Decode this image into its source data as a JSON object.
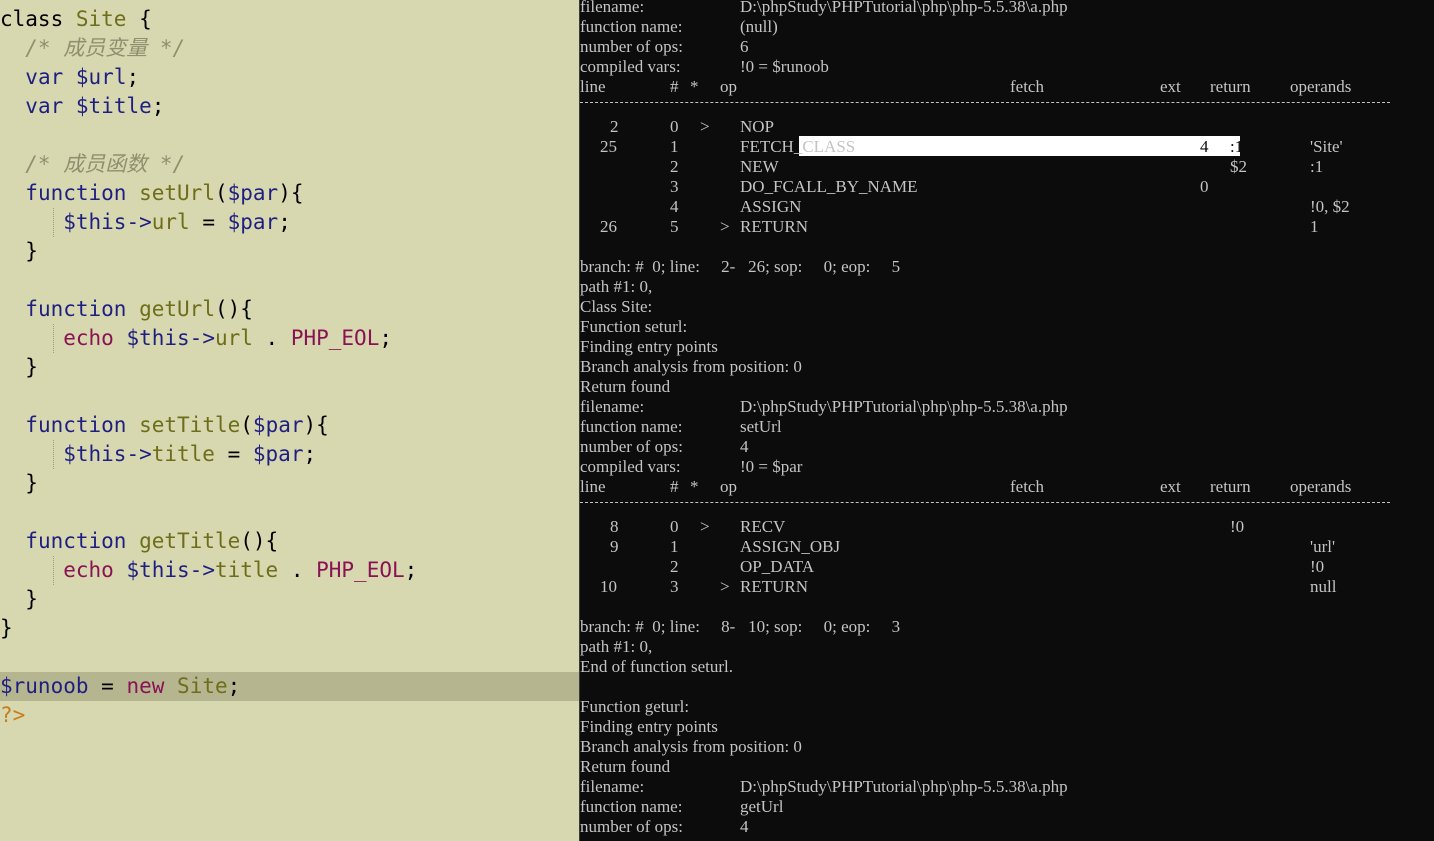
{
  "editor": {
    "lines": [
      [
        {
          "t": "class",
          "c": "plain"
        },
        {
          "t": " ",
          "c": "plain"
        },
        {
          "t": "Site",
          "c": "cls"
        },
        {
          "t": " {",
          "c": "plain"
        }
      ],
      [
        {
          "t": "  /* 成员变量 */",
          "c": "cmt"
        }
      ],
      [
        {
          "t": "  ",
          "c": "plain"
        },
        {
          "t": "var",
          "c": "kw"
        },
        {
          "t": " ",
          "c": "plain"
        },
        {
          "t": "$url",
          "c": "var"
        },
        {
          "t": ";",
          "c": "plain"
        }
      ],
      [
        {
          "t": "  ",
          "c": "plain"
        },
        {
          "t": "var",
          "c": "kw"
        },
        {
          "t": " ",
          "c": "plain"
        },
        {
          "t": "$title",
          "c": "var"
        },
        {
          "t": ";",
          "c": "plain"
        }
      ],
      [],
      [
        {
          "t": "  /* 成员函数 */",
          "c": "cmt"
        }
      ],
      [
        {
          "t": "  ",
          "c": "plain"
        },
        {
          "t": "function",
          "c": "kw"
        },
        {
          "t": " ",
          "c": "plain"
        },
        {
          "t": "setUrl",
          "c": "fn"
        },
        {
          "t": "(",
          "c": "plain"
        },
        {
          "t": "$par",
          "c": "var"
        },
        {
          "t": "){",
          "c": "plain"
        }
      ],
      [
        {
          "t": "     ",
          "c": "plain"
        },
        {
          "t": "$this",
          "c": "var"
        },
        {
          "t": "->",
          "c": "var"
        },
        {
          "t": "url",
          "c": "prop"
        },
        {
          "t": " = ",
          "c": "plain"
        },
        {
          "t": "$par",
          "c": "var"
        },
        {
          "t": ";",
          "c": "plain"
        }
      ],
      [
        {
          "t": "  }",
          "c": "plain"
        }
      ],
      [],
      [
        {
          "t": "  ",
          "c": "plain"
        },
        {
          "t": "function",
          "c": "kw"
        },
        {
          "t": " ",
          "c": "plain"
        },
        {
          "t": "getUrl",
          "c": "fn"
        },
        {
          "t": "(){",
          "c": "plain"
        }
      ],
      [
        {
          "t": "     ",
          "c": "plain"
        },
        {
          "t": "echo",
          "c": "const"
        },
        {
          "t": " ",
          "c": "plain"
        },
        {
          "t": "$this",
          "c": "var"
        },
        {
          "t": "->",
          "c": "var"
        },
        {
          "t": "url",
          "c": "prop"
        },
        {
          "t": " . ",
          "c": "plain"
        },
        {
          "t": "PHP_EOL",
          "c": "const"
        },
        {
          "t": ";",
          "c": "plain"
        }
      ],
      [
        {
          "t": "  }",
          "c": "plain"
        }
      ],
      [],
      [
        {
          "t": "  ",
          "c": "plain"
        },
        {
          "t": "function",
          "c": "kw"
        },
        {
          "t": " ",
          "c": "plain"
        },
        {
          "t": "setTitle",
          "c": "fn"
        },
        {
          "t": "(",
          "c": "plain"
        },
        {
          "t": "$par",
          "c": "var"
        },
        {
          "t": "){",
          "c": "plain"
        }
      ],
      [
        {
          "t": "     ",
          "c": "plain"
        },
        {
          "t": "$this",
          "c": "var"
        },
        {
          "t": "->",
          "c": "var"
        },
        {
          "t": "title",
          "c": "prop"
        },
        {
          "t": " = ",
          "c": "plain"
        },
        {
          "t": "$par",
          "c": "var"
        },
        {
          "t": ";",
          "c": "plain"
        }
      ],
      [
        {
          "t": "  }",
          "c": "plain"
        }
      ],
      [],
      [
        {
          "t": "  ",
          "c": "plain"
        },
        {
          "t": "function",
          "c": "kw"
        },
        {
          "t": " ",
          "c": "plain"
        },
        {
          "t": "getTitle",
          "c": "fn"
        },
        {
          "t": "(){",
          "c": "plain"
        }
      ],
      [
        {
          "t": "     ",
          "c": "plain"
        },
        {
          "t": "echo",
          "c": "const"
        },
        {
          "t": " ",
          "c": "plain"
        },
        {
          "t": "$this",
          "c": "var"
        },
        {
          "t": "->",
          "c": "var"
        },
        {
          "t": "title",
          "c": "prop"
        },
        {
          "t": " . ",
          "c": "plain"
        },
        {
          "t": "PHP_EOL",
          "c": "const"
        },
        {
          "t": ";",
          "c": "plain"
        }
      ],
      [
        {
          "t": "  }",
          "c": "plain"
        }
      ],
      [
        {
          "t": "}",
          "c": "plain"
        }
      ],
      [],
      [
        {
          "t": "$runoob",
          "c": "var"
        },
        {
          "t": " = ",
          "c": "plain"
        },
        {
          "t": "new",
          "c": "new"
        },
        {
          "t": " ",
          "c": "plain"
        },
        {
          "t": "Site",
          "c": "cls"
        },
        {
          "t": ";",
          "c": "plain"
        }
      ],
      [
        {
          "t": "?>",
          "c": "tag"
        }
      ]
    ]
  },
  "console": {
    "rows": [
      [
        [
          0,
          "filename:"
        ],
        [
          160,
          "D:\\phpStudy\\PHPTutorial\\php\\php-5.5.38\\a.php"
        ]
      ],
      [
        [
          0,
          "function name:"
        ],
        [
          160,
          "(null)"
        ]
      ],
      [
        [
          0,
          "number of ops:"
        ],
        [
          160,
          "6"
        ]
      ],
      [
        [
          0,
          "compiled vars:"
        ],
        [
          160,
          "!0 = $runoob"
        ]
      ],
      [
        [
          0,
          "line"
        ],
        [
          90,
          "#"
        ],
        [
          110,
          "*"
        ],
        [
          140,
          "op"
        ],
        [
          430,
          "fetch"
        ],
        [
          580,
          "ext"
        ],
        [
          630,
          "return"
        ],
        [
          710,
          "operands"
        ]
      ],
      [],
      [
        [
          30,
          "2"
        ],
        [
          90,
          "0"
        ],
        [
          120,
          ">"
        ],
        [
          160,
          "NOP"
        ]
      ],
      [
        [
          20,
          "25"
        ],
        [
          90,
          "1"
        ],
        [
          160,
          "FETCH_CLASS"
        ],
        [
          620,
          "4"
        ],
        [
          650,
          ":1"
        ],
        [
          730,
          "'Site'"
        ]
      ],
      [
        [
          90,
          "2"
        ],
        [
          160,
          "NEW"
        ],
        [
          650,
          "$2"
        ],
        [
          730,
          ":1"
        ]
      ],
      [
        [
          90,
          "3"
        ],
        [
          160,
          "DO_FCALL_BY_NAME"
        ],
        [
          620,
          "0"
        ]
      ],
      [
        [
          90,
          "4"
        ],
        [
          160,
          "ASSIGN"
        ],
        [
          730,
          "!0, $2"
        ]
      ],
      [
        [
          20,
          "26"
        ],
        [
          90,
          "5"
        ],
        [
          140,
          ">"
        ],
        [
          160,
          "RETURN"
        ],
        [
          730,
          "1"
        ]
      ],
      [],
      [
        [
          0,
          "branch: #  0; line:     2-   26; sop:     0; eop:     5"
        ]
      ],
      [
        [
          0,
          "path #1: 0,"
        ]
      ],
      [
        [
          0,
          "Class Site:"
        ]
      ],
      [
        [
          0,
          "Function seturl:"
        ]
      ],
      [
        [
          0,
          "Finding entry points"
        ]
      ],
      [
        [
          0,
          "Branch analysis from position: 0"
        ]
      ],
      [
        [
          0,
          "Return found"
        ]
      ],
      [
        [
          0,
          "filename:"
        ],
        [
          160,
          "D:\\phpStudy\\PHPTutorial\\php\\php-5.5.38\\a.php"
        ]
      ],
      [
        [
          0,
          "function name:"
        ],
        [
          160,
          "setUrl"
        ]
      ],
      [
        [
          0,
          "number of ops:"
        ],
        [
          160,
          "4"
        ]
      ],
      [
        [
          0,
          "compiled vars:"
        ],
        [
          160,
          "!0 = $par"
        ]
      ],
      [
        [
          0,
          "line"
        ],
        [
          90,
          "#"
        ],
        [
          110,
          "*"
        ],
        [
          140,
          "op"
        ],
        [
          430,
          "fetch"
        ],
        [
          580,
          "ext"
        ],
        [
          630,
          "return"
        ],
        [
          710,
          "operands"
        ]
      ],
      [],
      [
        [
          30,
          "8"
        ],
        [
          90,
          "0"
        ],
        [
          120,
          ">"
        ],
        [
          160,
          "RECV"
        ],
        [
          650,
          "!0"
        ]
      ],
      [
        [
          30,
          "9"
        ],
        [
          90,
          "1"
        ],
        [
          160,
          "ASSIGN_OBJ"
        ],
        [
          730,
          "'url'"
        ]
      ],
      [
        [
          90,
          "2"
        ],
        [
          160,
          "OP_DATA"
        ],
        [
          730,
          "!0"
        ]
      ],
      [
        [
          20,
          "10"
        ],
        [
          90,
          "3"
        ],
        [
          140,
          ">"
        ],
        [
          160,
          "RETURN"
        ],
        [
          730,
          "null"
        ]
      ],
      [],
      [
        [
          0,
          "branch: #  0; line:     8-   10; sop:     0; eop:     3"
        ]
      ],
      [
        [
          0,
          "path #1: 0,"
        ]
      ],
      [
        [
          0,
          "End of function seturl."
        ]
      ],
      [],
      [
        [
          0,
          "Function geturl:"
        ]
      ],
      [
        [
          0,
          "Finding entry points"
        ]
      ],
      [
        [
          0,
          "Branch analysis from position: 0"
        ]
      ],
      [
        [
          0,
          "Return found"
        ]
      ],
      [
        [
          0,
          "filename:"
        ],
        [
          160,
          "D:\\phpStudy\\PHPTutorial\\php\\php-5.5.38\\a.php"
        ]
      ],
      [
        [
          0,
          "function name:"
        ],
        [
          160,
          "getUrl"
        ]
      ],
      [
        [
          0,
          "number of ops:"
        ],
        [
          160,
          "4"
        ]
      ]
    ]
  }
}
